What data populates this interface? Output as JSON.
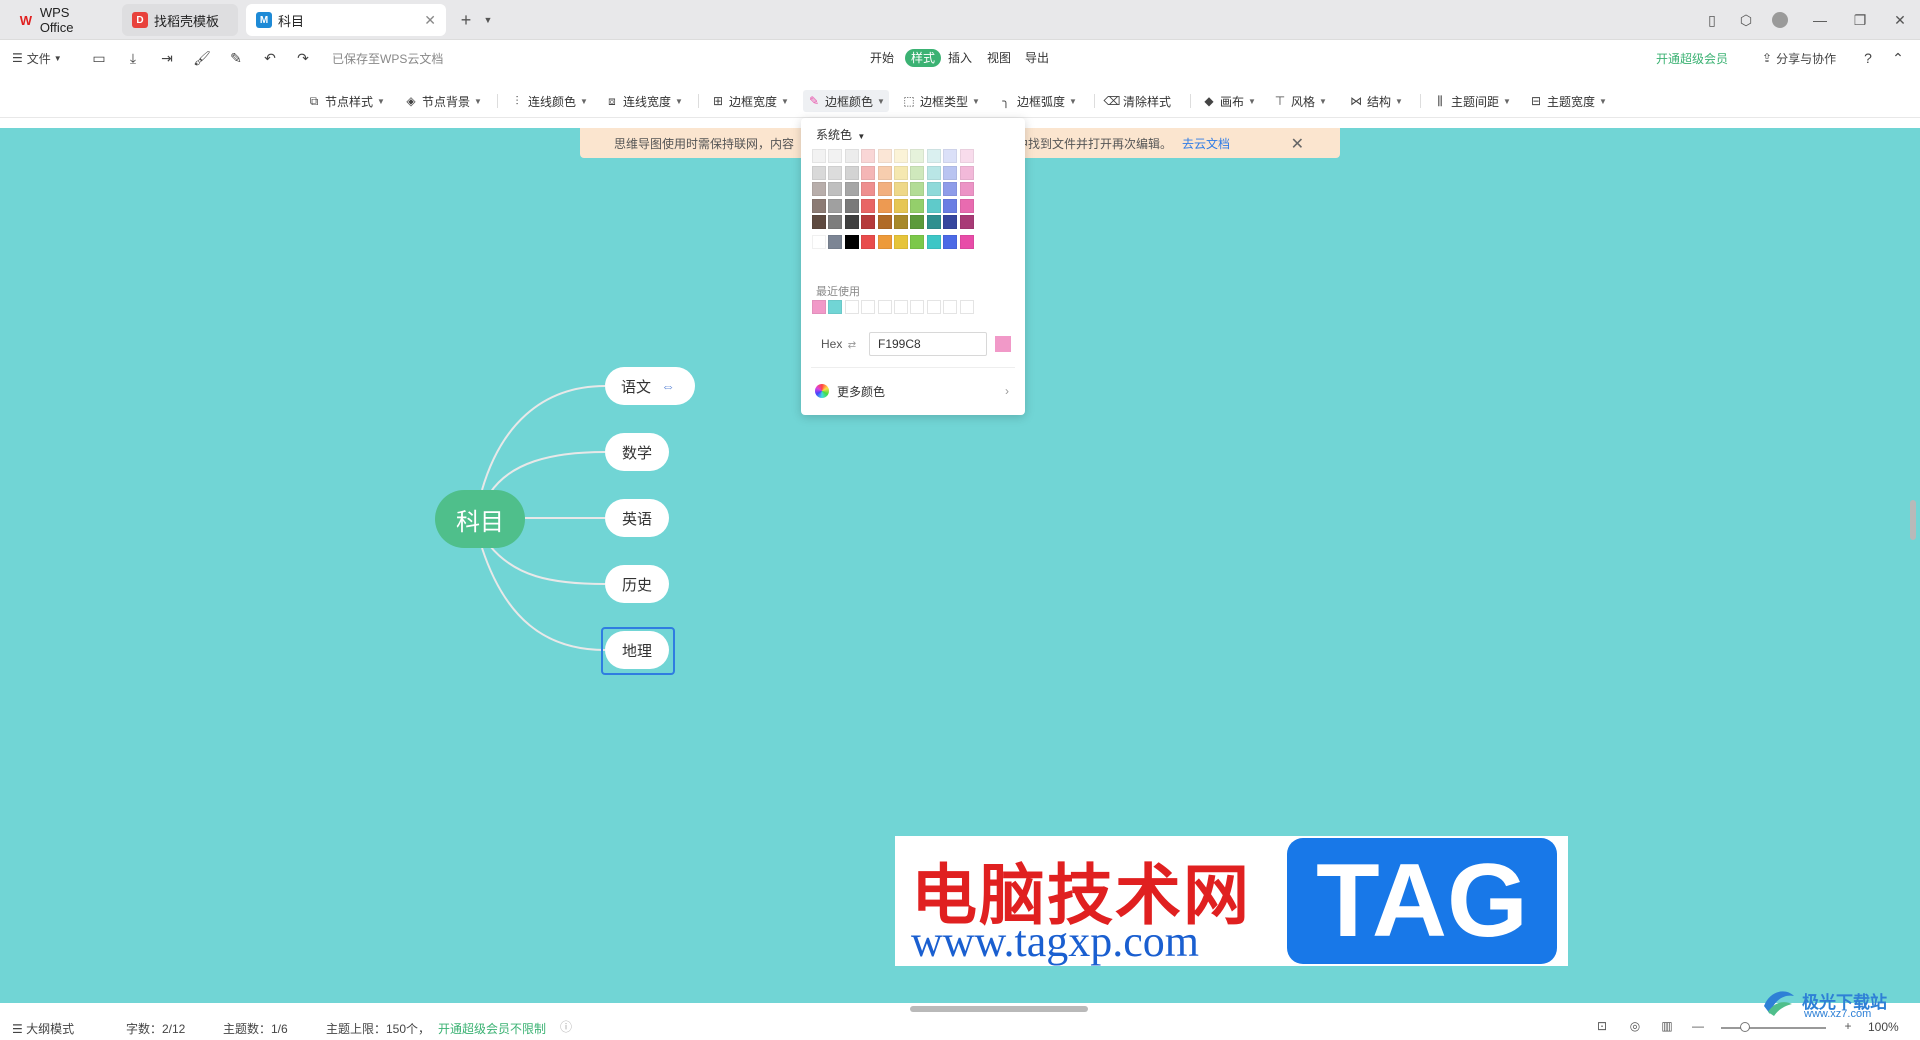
{
  "tabs": [
    {
      "label": "WPS Office",
      "icon": "wps-logo-icon"
    },
    {
      "label": "找稻壳模板",
      "icon": "docer-icon"
    },
    {
      "label": "科目",
      "icon": "mindmap-icon",
      "active": true
    }
  ],
  "menubar": {
    "file_label": "文件",
    "saved_status": "已保存至WPS云文档",
    "tabs": [
      "开始",
      "样式",
      "插入",
      "视图",
      "导出"
    ],
    "active_tab": "样式",
    "vip_label": "开通超级会员",
    "share_label": "分享与协作"
  },
  "toolbar": {
    "items": [
      "节点样式",
      "节点背景",
      "连线颜色",
      "连线宽度",
      "边框宽度",
      "边框颜色",
      "边框类型",
      "边框弧度",
      "清除样式",
      "画布",
      "风格",
      "结构",
      "主题间距",
      "主题宽度"
    ],
    "active": "边框颜色"
  },
  "notice": {
    "text": "思维导图使用时需保持联网，内容",
    "text_tail": "文档中找到文件并打开再次编辑。",
    "link": "去云文档"
  },
  "mindmap": {
    "root": "科目",
    "children": [
      "语文",
      "数学",
      "英语",
      "历史",
      "地理"
    ],
    "selected": "地理",
    "colors": {
      "canvas": "#71d5d5",
      "root": "#4fbf8b",
      "line": "#e8e8e8",
      "selection": "#2f7de1"
    }
  },
  "color_popup": {
    "header": "系统色",
    "grid": [
      [
        "#f2f2f2",
        "#f2f2f2",
        "#ececec",
        "#f9d6d6",
        "#fbe6d6",
        "#fbf3d7",
        "#e6f2db",
        "#daf0f0",
        "#dbe0f8",
        "#f8dcec"
      ],
      [
        "#d9d9d9",
        "#dcdcdc",
        "#d3d3d3",
        "#f4b6b6",
        "#f7cdae",
        "#f5e8b0",
        "#cfe8bc",
        "#b9e6e6",
        "#b9c4f1",
        "#f2b9d9"
      ],
      [
        "#b8aeab",
        "#bfbfbf",
        "#a6a6a6",
        "#ee8f8f",
        "#f2b07f",
        "#eed889",
        "#b3dc96",
        "#8fd9d9",
        "#8e9ce9",
        "#ec94c6"
      ],
      [
        "#8c7b74",
        "#a0a0a0",
        "#7a7a7a",
        "#e86565",
        "#ed9a52",
        "#e6c654",
        "#94cf6b",
        "#5fcaca",
        "#6a7ee3",
        "#e86bb0"
      ],
      [
        "#5e4a40",
        "#7d7d7d",
        "#3f3f3f",
        "#b53a3a",
        "#b06a27",
        "#a8892a",
        "#5c9a3b",
        "#2f8f8f",
        "#36469e",
        "#a83a76"
      ],
      [
        "#ffffff",
        "#7c8594",
        "#000000",
        "#e84c4c",
        "#ed9a3a",
        "#e6c43a",
        "#7cc84a",
        "#3ec6c6",
        "#4c6ae6",
        "#e84ca8"
      ]
    ],
    "recent_label": "最近使用",
    "recent": [
      "#f199c8",
      "#71d5d5"
    ],
    "hex_label": "Hex",
    "hex_value": "F199C8",
    "hex_color": "#f199c8",
    "more_label": "更多颜色"
  },
  "watermark": {
    "title": "电脑技术网",
    "url": "www.tagxp.com",
    "tag": "TAG"
  },
  "statusbar": {
    "outline_mode": "大纲模式",
    "word_count": "字数：2/12",
    "topic_count": "主题数：1/6",
    "topic_limit": "主题上限：150个，",
    "vip_unlimited": "开通超级会员不限制",
    "zoom": "100%"
  },
  "corner_logo": {
    "name": "极光下载站",
    "url": "www.xz7.com"
  }
}
